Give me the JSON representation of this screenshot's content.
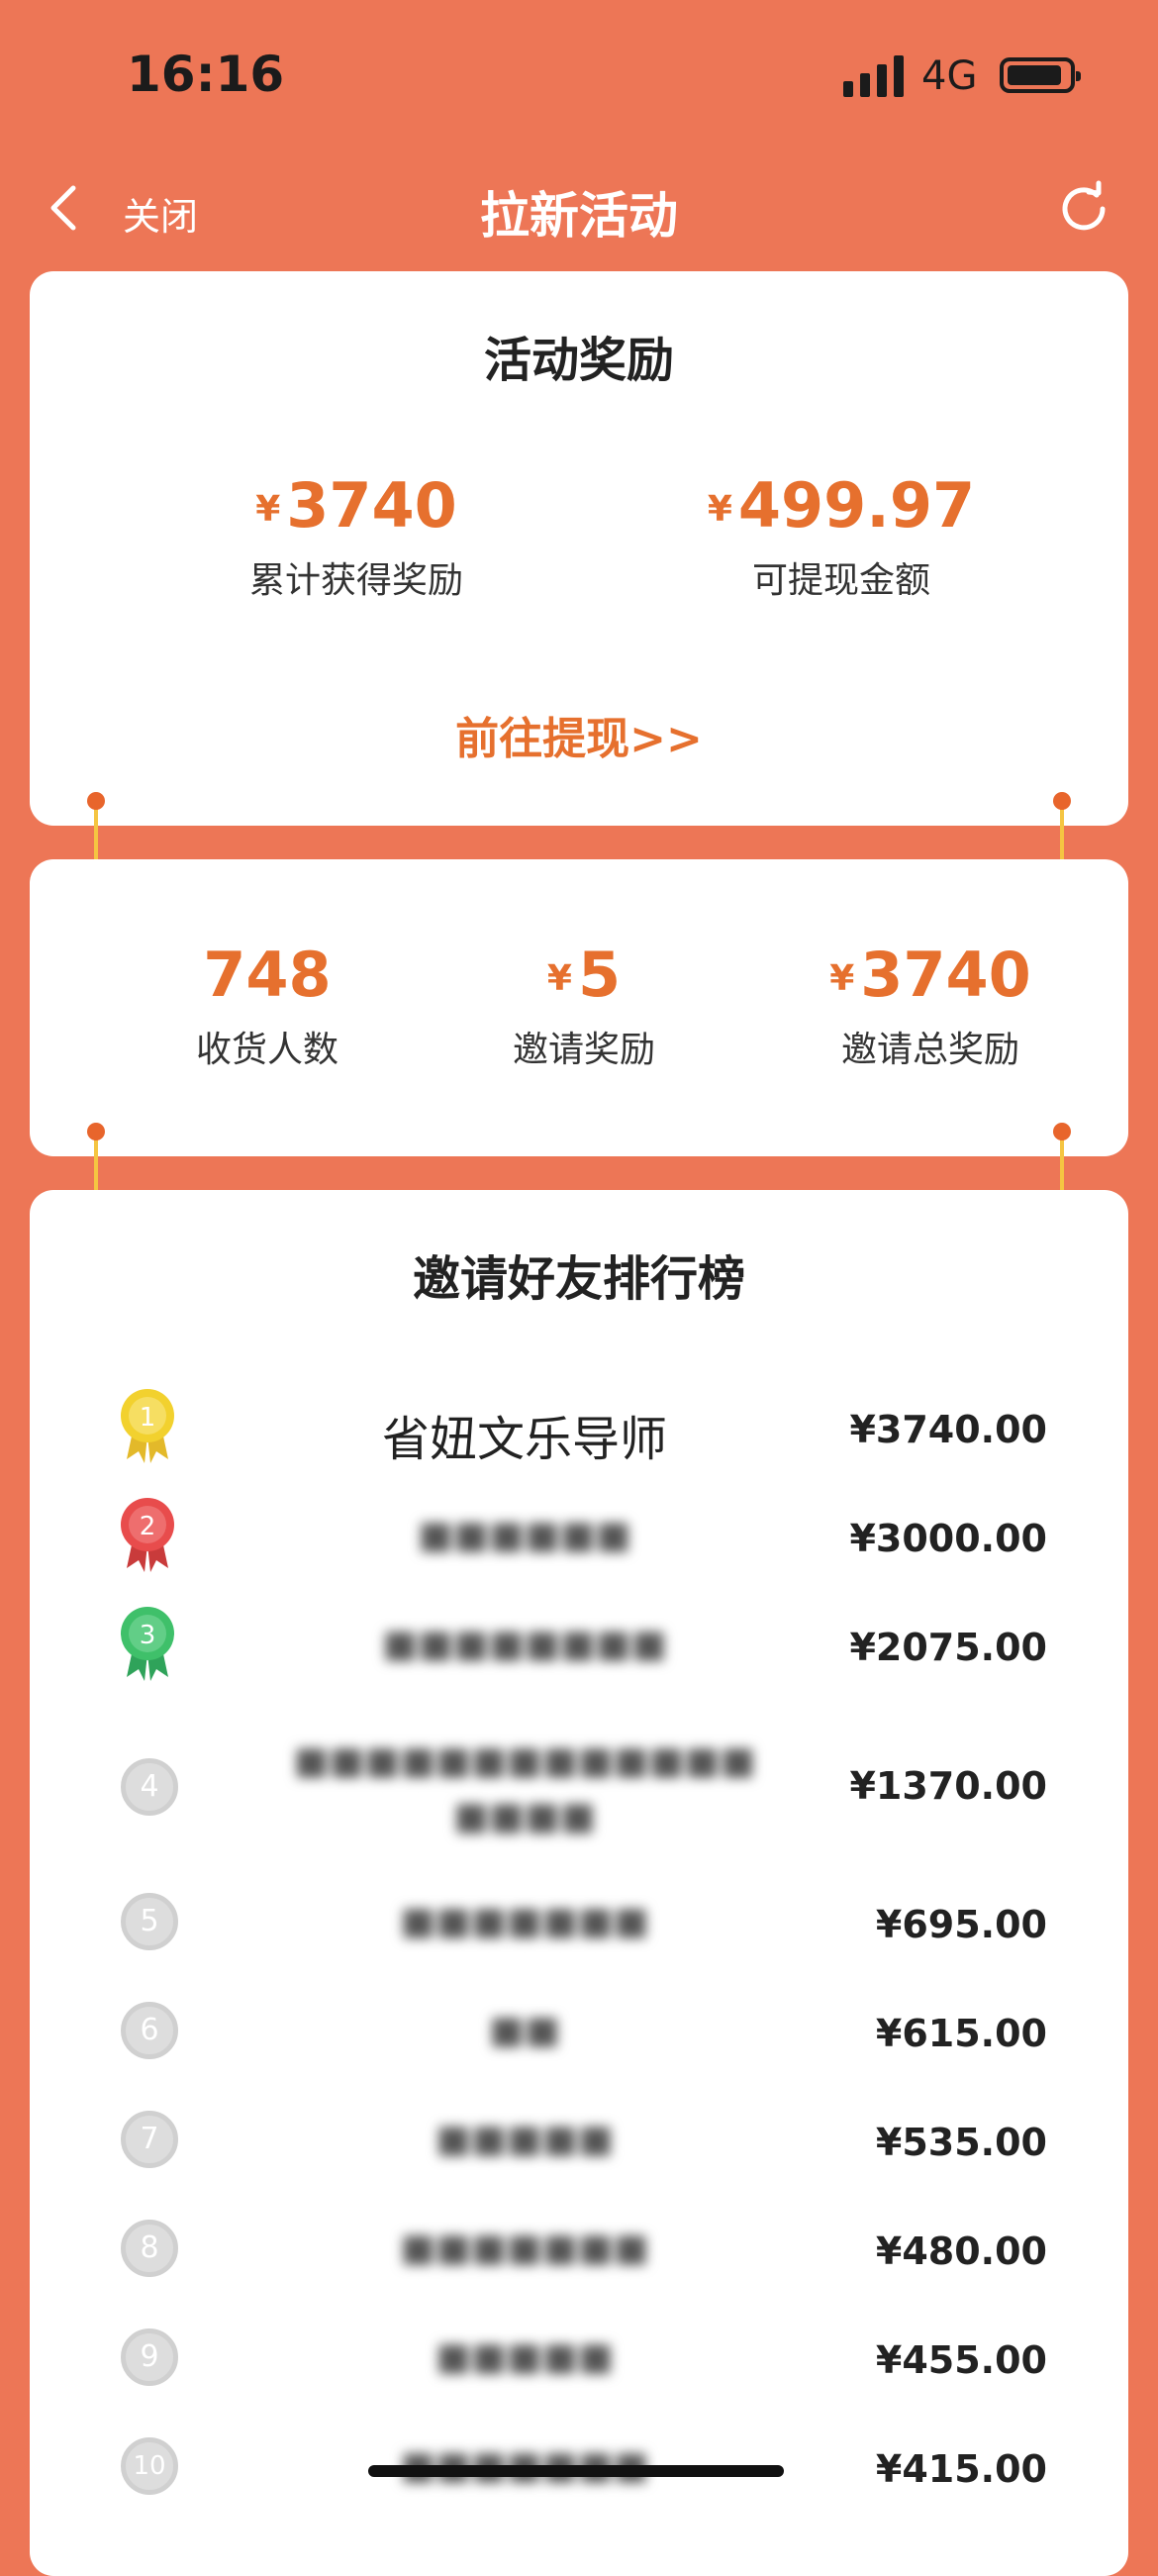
{
  "status": {
    "time": "16:16",
    "network": "4G"
  },
  "nav": {
    "close_label": "关闭",
    "title": "拉新活动"
  },
  "reward_card": {
    "title": "活动奖励",
    "total": {
      "currency": "¥",
      "value": "3740",
      "label": "累计获得奖励"
    },
    "withdrawable": {
      "currency": "¥",
      "value": "499.97",
      "label": "可提现金额"
    },
    "withdraw_link": "前往提现>>"
  },
  "stats_card": {
    "receivers": {
      "value": "748",
      "label": "收货人数"
    },
    "invite_reward": {
      "currency": "¥",
      "value": "5",
      "label": "邀请奖励"
    },
    "invite_total": {
      "currency": "¥",
      "value": "3740",
      "label": "邀请总奖励"
    }
  },
  "leaderboard": {
    "title": "邀请好友排行榜",
    "rows": [
      {
        "rank": "1",
        "name": "省妞文乐导师",
        "amount": "¥3740.00"
      },
      {
        "rank": "2",
        "name": "■■■■■■",
        "amount": "¥3000.00"
      },
      {
        "rank": "3",
        "name": "■■■■■■■■",
        "amount": "¥2075.00"
      },
      {
        "rank": "4",
        "name": "■■■■■■■■■■■■■ ■■■■",
        "amount": "¥1370.00"
      },
      {
        "rank": "5",
        "name": "■■■■■■■",
        "amount": "¥695.00"
      },
      {
        "rank": "6",
        "name": "■■",
        "amount": "¥615.00"
      },
      {
        "rank": "7",
        "name": "■■■■■",
        "amount": "¥535.00"
      },
      {
        "rank": "8",
        "name": "■■■■■■■",
        "amount": "¥480.00"
      },
      {
        "rank": "9",
        "name": "■■■■■",
        "amount": "¥455.00"
      },
      {
        "rank": "10",
        "name": "■■■■■■■",
        "amount": "¥415.00"
      }
    ]
  },
  "colors": {
    "background": "#ED7656",
    "accent": "#E6702E",
    "connector": "#F5C542",
    "gold": "#F2D12E",
    "red": "#E84C4C",
    "green": "#3FC06A"
  }
}
